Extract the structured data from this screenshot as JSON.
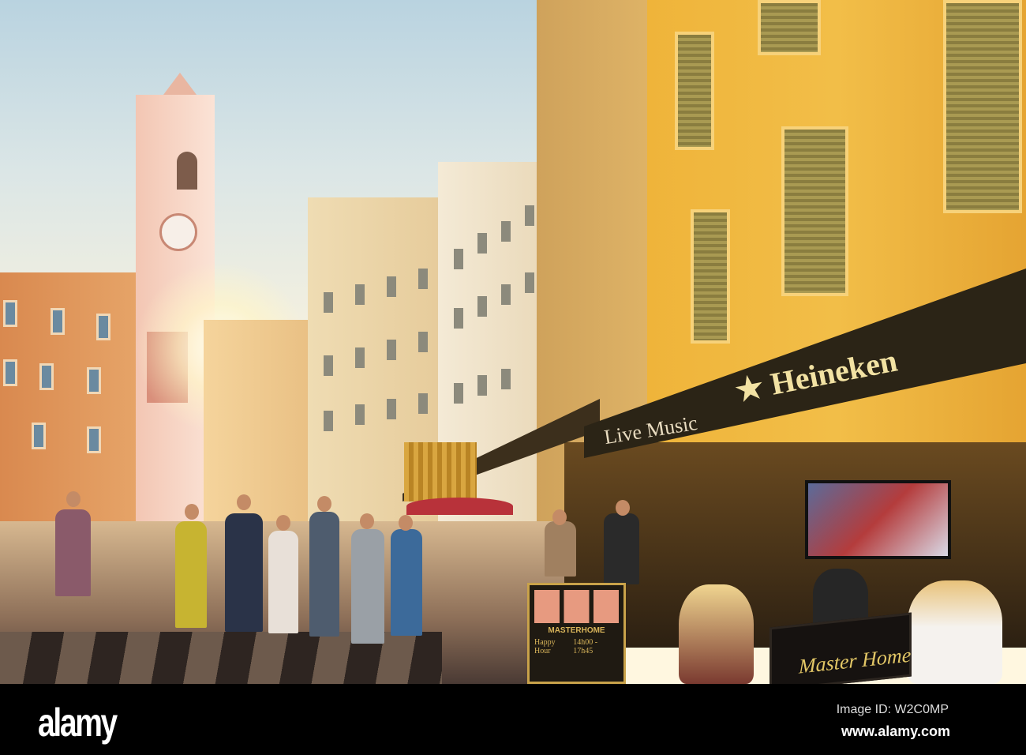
{
  "photo": {
    "awning_text": "Heineken",
    "awning_subtext": "Live Music",
    "menu_board": {
      "brand": "MASTERHOME",
      "happy_hour_label": "Happy Hour",
      "happy_hour_time": "14h00 - 17h45"
    },
    "sign_text": "Master Home"
  },
  "watermark_bar": {
    "logo": "alamy",
    "image_id": "Image ID: W2C0MP",
    "url": "www.alamy.com"
  }
}
